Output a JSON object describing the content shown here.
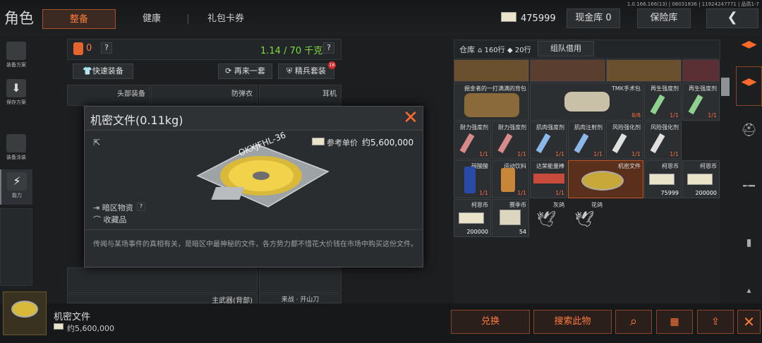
{
  "header": {
    "title": "角色",
    "tabs": [
      "整备",
      "健康",
      "礼包卡券"
    ],
    "version": "1.0.166.166(13) | 08031836 | 11924247771 | 品质1-7",
    "currency": "475999",
    "cash_label": "现金库 0",
    "vault_label": "保险库",
    "back_icon": "back-arrow-icon"
  },
  "leftbar": {
    "items": [
      {
        "label": "装备方案",
        "icon": "vest-icon"
      },
      {
        "label": "保存方案",
        "icon": "download-icon"
      },
      {
        "label": "装备涂装",
        "icon": "helmet-icon"
      },
      {
        "label": "能力",
        "icon": "lightning-icon"
      }
    ]
  },
  "loadout": {
    "weight_count": "0",
    "weight": "1.14 / 70 千克",
    "help": "?",
    "quick_equip": "快速装备",
    "reequip": "再来一套",
    "elite": "精兵套装",
    "elite_badge": "16",
    "slots": {
      "head": "头部装备",
      "armor": "防弹衣",
      "ear": "耳机",
      "main_weapon": "主武器(背部)",
      "melee": "来战 · 开山刀"
    }
  },
  "popup": {
    "title": "机密文件(0.11kg)",
    "price_label": "参考单价",
    "price": "约5,600,000",
    "item_art": "OKXJFHL-36",
    "tag": "暗区物资",
    "tag_help": "?",
    "collection": "收藏品",
    "description": "传闻与某场事件的真相有关，是暗区中最神秘的文件，各方势力都不惜花大价钱在市场中购买这份文件。"
  },
  "warehouse": {
    "label": "仓库",
    "rows1": "160行",
    "rows2": "20行",
    "team_loan": "组队借用",
    "cells": [
      {
        "name": "掘金者的一打满满的背包",
        "count": ""
      },
      {
        "name": "TMK手术包",
        "count": "8/8"
      },
      {
        "name": "再生强度剂",
        "count": "1/1"
      },
      {
        "name": "再生强度剂",
        "count": "1/1"
      },
      {
        "name": "耐力强度剂",
        "count": "1/1"
      },
      {
        "name": "耐力强度剂",
        "count": "1/1"
      },
      {
        "name": "肌肉强度剂",
        "count": "1/1"
      },
      {
        "name": "肌肉注射剂",
        "count": "1/1"
      },
      {
        "name": "风险强化剂",
        "count": "1/1"
      },
      {
        "name": "风险强化剂",
        "count": "1/1"
      },
      {
        "name": "碳酸酸",
        "count": "1/1"
      },
      {
        "name": "运动饮料",
        "count": "1/1"
      },
      {
        "name": "达荣能量棒",
        "count": "1/1"
      },
      {
        "name": "机密文件",
        "count": ""
      },
      {
        "name": "柯恩币",
        "count": "75999"
      },
      {
        "name": "柯恩币",
        "count": "200000"
      },
      {
        "name": "柯恩币",
        "count": "200000"
      },
      {
        "name": "赛季币",
        "count": "54"
      },
      {
        "name": "灰鸽",
        "count": ""
      },
      {
        "name": "花鸽",
        "count": ""
      }
    ]
  },
  "bottom": {
    "item_name": "机密文件",
    "item_price": "约5,600,000",
    "exchange": "兑换",
    "search_item": "搜索此物"
  },
  "colors": {
    "accent": "#ff7b3a",
    "green": "#7ddc3a",
    "red": "#ff5a2a"
  }
}
